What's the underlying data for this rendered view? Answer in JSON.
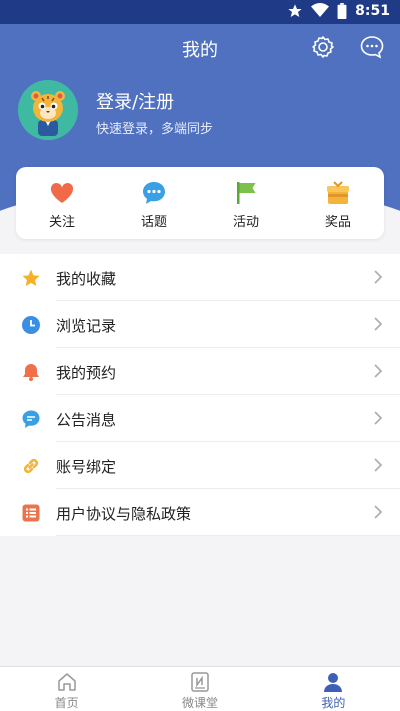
{
  "status_bar": {
    "time": "8:51"
  },
  "header": {
    "title": "我的"
  },
  "profile": {
    "login_text": "登录/注册",
    "subtitle": "快速登录，多端同步"
  },
  "quick_actions": [
    {
      "label": "关注",
      "icon": "heart-icon",
      "color": "#f06a4a"
    },
    {
      "label": "话题",
      "icon": "chat-bubble-icon",
      "color": "#3aa0e6"
    },
    {
      "label": "活动",
      "icon": "flag-icon",
      "color": "#7cc24a"
    },
    {
      "label": "奖品",
      "icon": "gift-icon",
      "color": "#f4b43a"
    }
  ],
  "menu": [
    {
      "label": "我的收藏",
      "icon": "star-icon",
      "color": "#f6b12a"
    },
    {
      "label": "浏览记录",
      "icon": "clock-icon",
      "color": "#3a8ee6"
    },
    {
      "label": "我的预约",
      "icon": "bell-icon",
      "color": "#f0704a"
    },
    {
      "label": "公告消息",
      "icon": "message-icon",
      "color": "#3aa0e6"
    },
    {
      "label": "账号绑定",
      "icon": "link-icon",
      "color": "#f4b43a"
    },
    {
      "label": "用户协议与隐私政策",
      "icon": "list-icon",
      "color": "#e9744e"
    }
  ],
  "tabs": [
    {
      "label": "首页",
      "icon": "home-icon",
      "active": false
    },
    {
      "label": "微课堂",
      "icon": "notebook-icon",
      "active": false
    },
    {
      "label": "我的",
      "icon": "user-icon",
      "active": true
    }
  ],
  "colors": {
    "primary": "#4f71c0",
    "status_bar": "#1f3a86",
    "active_tab": "#3d5fb6"
  }
}
